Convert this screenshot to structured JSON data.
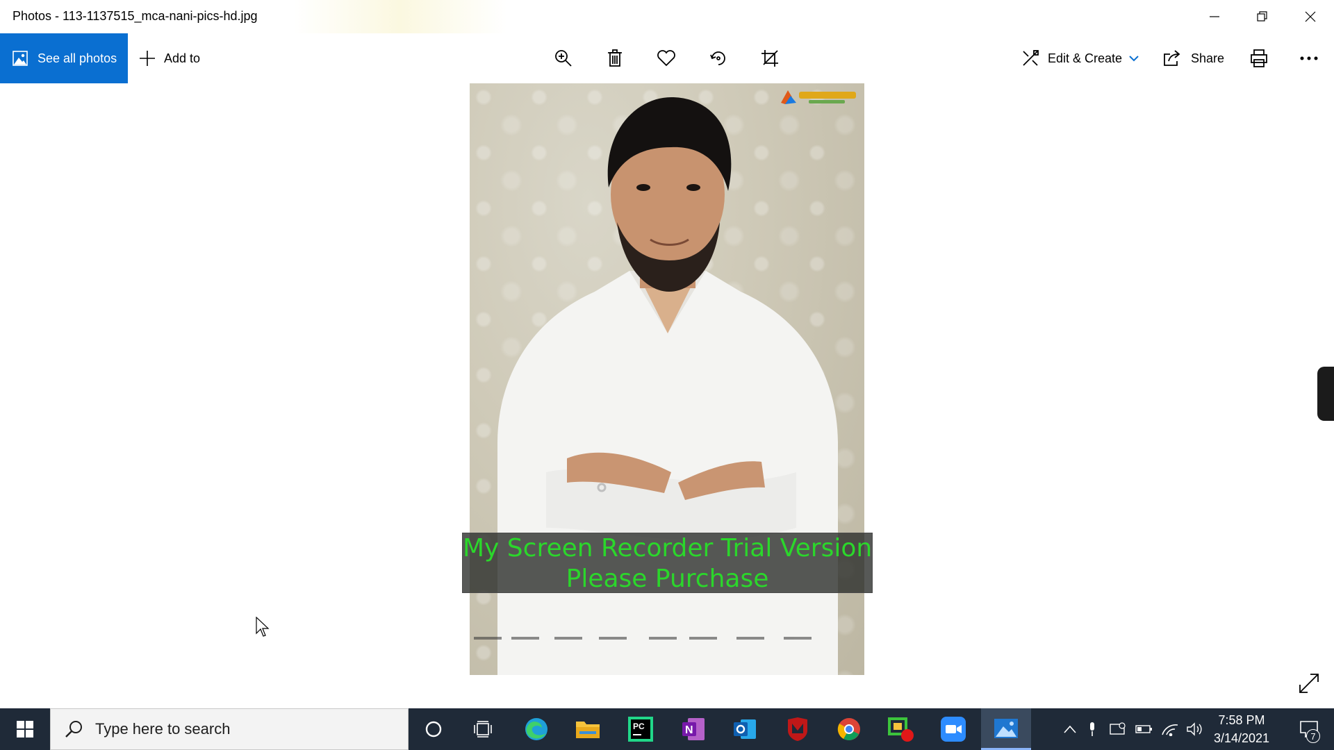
{
  "window": {
    "title": "Photos - 113-1137515_mca-nani-pics-hd.jpg",
    "controls": [
      "minimize-icon",
      "restore-icon",
      "close-icon"
    ]
  },
  "toolbar": {
    "see_all_photos": "See all photos",
    "add_to": "Add to",
    "center_tools": [
      "zoom-icon",
      "delete-icon",
      "favorite-icon",
      "rotate-icon",
      "crop-icon"
    ],
    "edit_create": "Edit & Create",
    "share": "Share",
    "right_tools": [
      "print-icon",
      "more-icon"
    ],
    "accent_color": "#0a6fd1"
  },
  "photo": {
    "subject": "photo of a man in white shirt with crossed arms against patterned wall",
    "overlay": {
      "line1": "My Screen Recorder Trial Version",
      "line2": "Please Purchase",
      "color": "#2bd72b"
    }
  },
  "taskbar": {
    "search_placeholder": "Type here to search",
    "pinned": [
      "cortana-icon",
      "task-view-icon",
      "edge-icon",
      "file-explorer-icon",
      "pycharm-icon",
      "onenote-icon",
      "outlook-icon",
      "mcafee-icon",
      "chrome-icon",
      "screen-recorder-icon",
      "zoom-icon",
      "photos-icon"
    ],
    "active_app": "photos-icon",
    "tray": [
      "show-hidden-icons-icon",
      "microphone-icon",
      "display-icon",
      "battery-icon",
      "wifi-icon",
      "volume-icon"
    ],
    "time": "7:58 PM",
    "date": "3/14/2021",
    "notification_count": "7",
    "background": "#1f2a38"
  }
}
